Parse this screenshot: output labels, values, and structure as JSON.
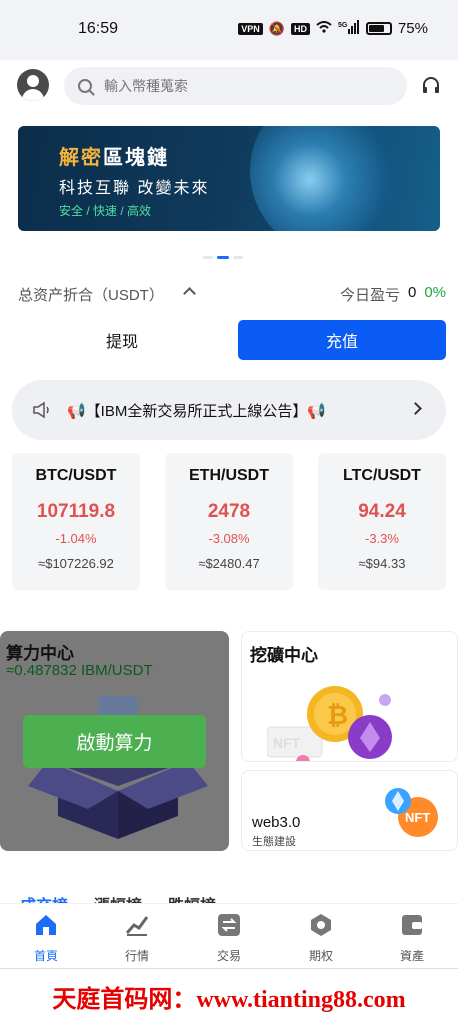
{
  "status_bar": {
    "time": "16:59",
    "vpn": "VPN",
    "hd": "HD",
    "network": "5G",
    "battery": "75%",
    "battery_level": 0.75
  },
  "header": {
    "search_placeholder": "輸入幣種蒐索"
  },
  "banner": {
    "title_accent": "解密",
    "title_rest": "區塊鏈",
    "subtitle": "科技互聯 改變未來",
    "tags": "安全 / 快速 / 高效"
  },
  "assets": {
    "label": "总资产折合（USDT）",
    "pnl_label": "今日盈亏",
    "pnl_value": "0",
    "pnl_pct": "0%",
    "withdraw_label": "提现",
    "deposit_label": "充值"
  },
  "notice": {
    "text": "📢【IBM全新交易所正式上線公告】📢"
  },
  "tickers": [
    {
      "pair": "BTC/USDT",
      "price": "107119.8",
      "change": "-1.04%",
      "usd": "≈$107226.92"
    },
    {
      "pair": "ETH/USDT",
      "price": "2478",
      "change": "-3.08%",
      "usd": "≈$2480.47"
    },
    {
      "pair": "LTC/USDT",
      "price": "94.24",
      "change": "-3.3%",
      "usd": "≈$94.33"
    }
  ],
  "power": {
    "title": "算力中心",
    "rate": "≈0.487832 IBM/USDT",
    "start_label": "啟動算力"
  },
  "mining": {
    "title": "挖礦中心",
    "nft_text": "NFT"
  },
  "web3": {
    "title": "web3.0",
    "subtitle": "生態建設",
    "nft_text": "NFT"
  },
  "rank_tabs": [
    "成交榜",
    "漲幅榜",
    "跌幅榜"
  ],
  "nav": [
    {
      "label": "首頁",
      "icon": "home-icon",
      "active": true
    },
    {
      "label": "行情",
      "icon": "market-icon",
      "active": false
    },
    {
      "label": "交易",
      "icon": "trade-icon",
      "active": false
    },
    {
      "label": "期权",
      "icon": "options-icon",
      "active": false
    },
    {
      "label": "資產",
      "icon": "wallet-icon",
      "active": false
    }
  ],
  "watermark": "天庭首码网：www.tianting88.com",
  "colors": {
    "primary": "#0a5cf5",
    "down": "#e05252",
    "up": "#1aaa3a",
    "start_button": "#4cb050"
  }
}
